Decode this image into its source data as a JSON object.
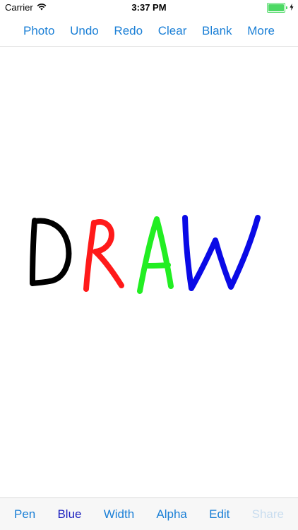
{
  "status_bar": {
    "carrier": "Carrier",
    "time": "3:37 PM",
    "battery_level": 1.0,
    "icons": [
      "wifi-icon",
      "battery-icon",
      "charging-icon"
    ]
  },
  "top_toolbar": {
    "items": [
      {
        "label": "Photo"
      },
      {
        "label": "Undo"
      },
      {
        "label": "Redo"
      },
      {
        "label": "Clear"
      },
      {
        "label": "Blank"
      },
      {
        "label": "More"
      }
    ]
  },
  "canvas": {
    "strokes": [
      {
        "letter": "D",
        "color": "#000000"
      },
      {
        "letter": "R",
        "color": "#ff1a1a"
      },
      {
        "letter": "A",
        "color": "#22ee22"
      },
      {
        "letter": "W",
        "color": "#0a0ae6"
      }
    ]
  },
  "bottom_toolbar": {
    "items": [
      {
        "label": "Pen"
      },
      {
        "label": "Blue"
      },
      {
        "label": "Width"
      },
      {
        "label": "Alpha"
      },
      {
        "label": "Edit"
      },
      {
        "label": "Share"
      }
    ]
  },
  "colors": {
    "accent": "#1a7fd6",
    "selected": "#1b1fbf",
    "disabled": "#c9ddef"
  }
}
